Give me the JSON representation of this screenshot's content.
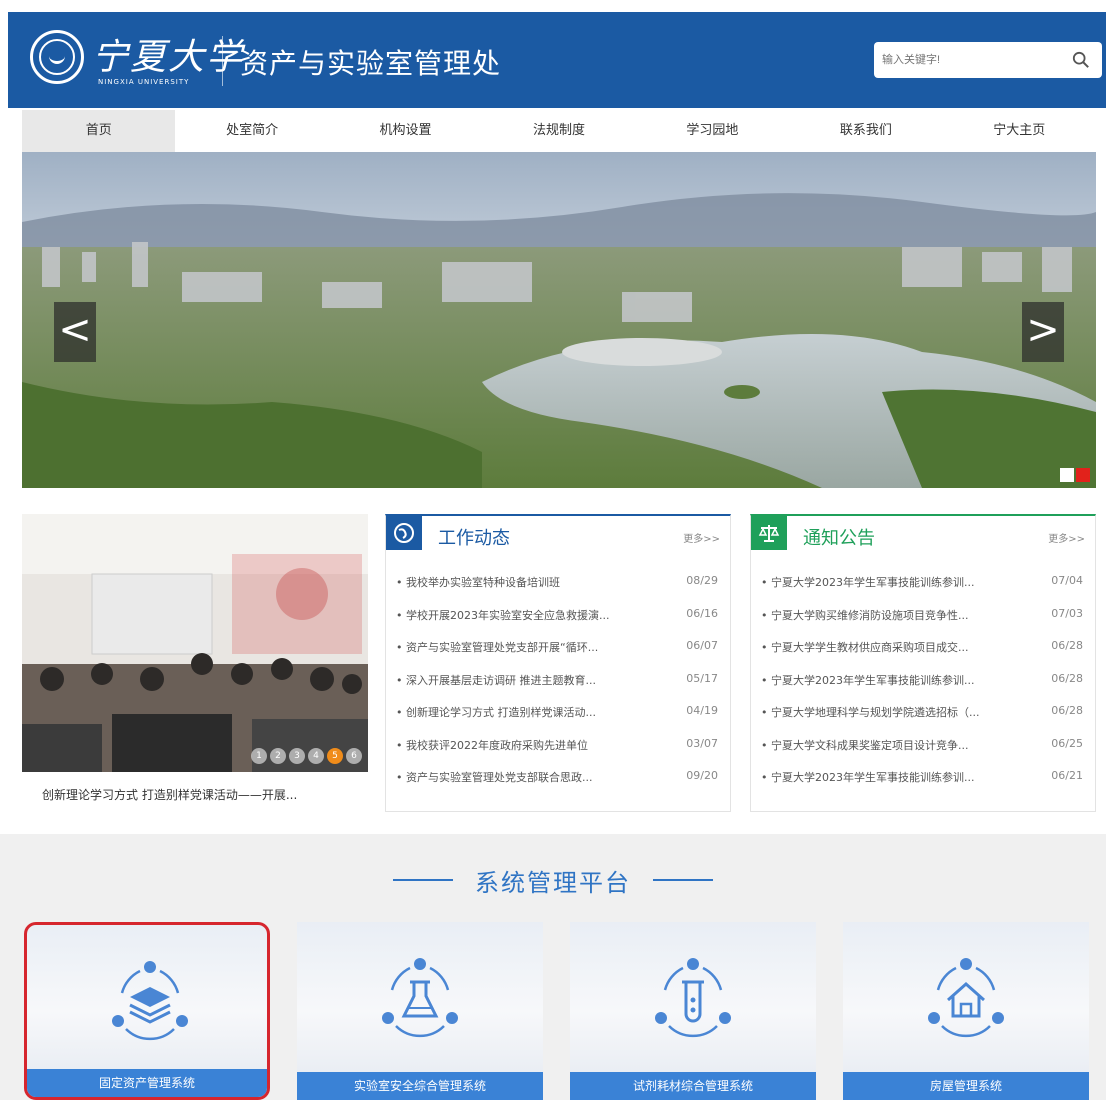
{
  "header": {
    "logo_text": "宁夏大学",
    "logo_sub": "NINGXIA UNIVERSITY",
    "site_title": "资产与实验室管理处",
    "search_placeholder": "输入关键字!"
  },
  "nav": [
    "首页",
    "处室简介",
    "机构设置",
    "法规制度",
    "学习园地",
    "联系我们",
    "宁大主页"
  ],
  "banner": {
    "prev_glyph": "<",
    "next_glyph": ">"
  },
  "news_photo": {
    "caption": "创新理论学习方式 打造别样党课活动——开展...",
    "dots": [
      "1",
      "2",
      "3",
      "4",
      "5",
      "6"
    ]
  },
  "work_panel": {
    "title": "工作动态",
    "more": "更多>>",
    "items": [
      {
        "text": "我校举办实验室特种设备培训班",
        "date": "08/29"
      },
      {
        "text": "学校开展2023年实验室安全应急救援演...",
        "date": "06/16"
      },
      {
        "text": "资产与实验室管理处党支部开展“循环...",
        "date": "06/07"
      },
      {
        "text": "深入开展基层走访调研 推进主题教育...",
        "date": "05/17"
      },
      {
        "text": "创新理论学习方式 打造别样党课活动...",
        "date": "04/19"
      },
      {
        "text": "我校获评2022年度政府采购先进单位",
        "date": "03/07"
      },
      {
        "text": "资产与实验室管理处党支部联合思政...",
        "date": "09/20"
      }
    ]
  },
  "notice_panel": {
    "title": "通知公告",
    "more": "更多>>",
    "items": [
      {
        "text": "宁夏大学2023年学生军事技能训练参训...",
        "date": "07/04"
      },
      {
        "text": "宁夏大学购买维修消防设施项目竞争性...",
        "date": "07/03"
      },
      {
        "text": "宁夏大学学生教材供应商采购项目成交...",
        "date": "06/28"
      },
      {
        "text": "宁夏大学2023年学生军事技能训练参训...",
        "date": "06/28"
      },
      {
        "text": "宁夏大学地理科学与规划学院遴选招标（...",
        "date": "06/28"
      },
      {
        "text": "宁夏大学文科成果奖鉴定项目设计竞争...",
        "date": "06/25"
      },
      {
        "text": "宁夏大学2023年学生军事技能训练参训...",
        "date": "06/21"
      }
    ]
  },
  "platform": {
    "title": "系统管理平台",
    "cards": [
      {
        "label": "固定资产管理系统",
        "icon": "layers-icon"
      },
      {
        "label": "实验室安全综合管理系统",
        "icon": "flask-icon"
      },
      {
        "label": "试剂耗材综合管理系统",
        "icon": "test-tube-icon"
      },
      {
        "label": "房屋管理系统",
        "icon": "house-icon"
      }
    ]
  },
  "colors": {
    "header_bg": "#1b5aa3",
    "accent_blue": "#2f74c4",
    "notice_green": "#1fa05a",
    "highlight_red": "#d6262e"
  }
}
